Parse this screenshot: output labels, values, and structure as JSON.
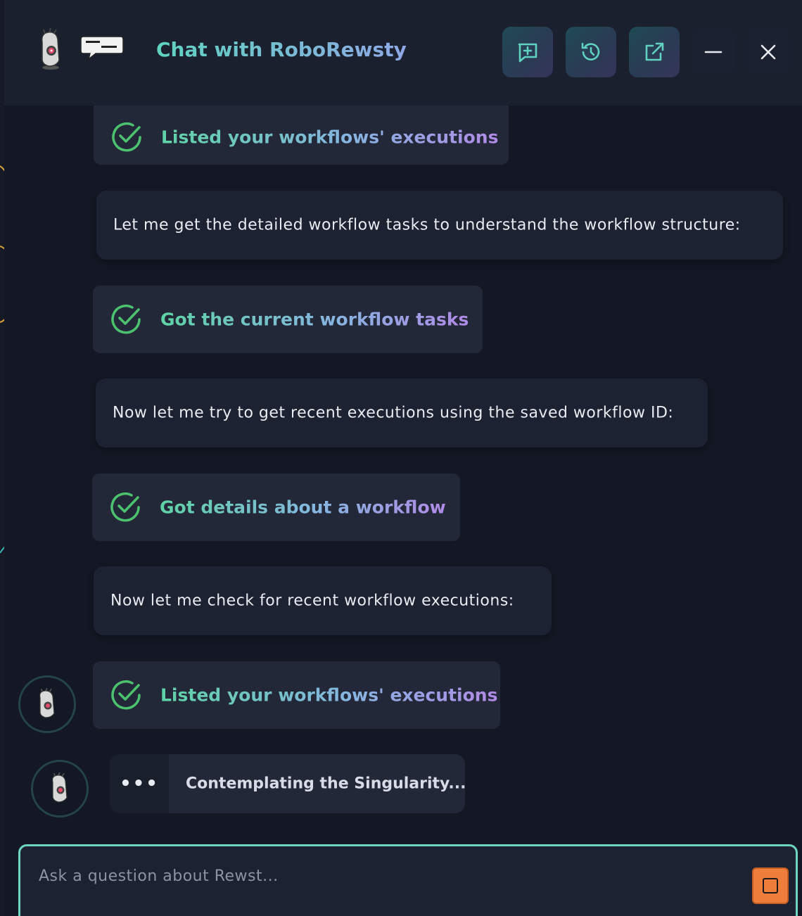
{
  "header": {
    "title": "Chat with RoboRewsty",
    "buttons": {
      "new_chat": "new-chat-icon",
      "history": "history-icon",
      "pop_out": "external-link-icon",
      "minimize": "minimize-icon",
      "close": "close-icon"
    }
  },
  "messages": [
    {
      "type": "tool",
      "label": "Listed your workflows' executions"
    },
    {
      "type": "text",
      "text": "Let me get the detailed workflow tasks to understand the workflow structure:"
    },
    {
      "type": "tool",
      "label": "Got the current workflow tasks"
    },
    {
      "type": "text",
      "text": "Now let me try to get recent executions using the saved workflow ID:"
    },
    {
      "type": "tool",
      "label": "Got details about a workflow"
    },
    {
      "type": "text",
      "text": "Now let me check for recent workflow executions:"
    },
    {
      "type": "tool",
      "label": "Listed your workflows' executions"
    }
  ],
  "typing": {
    "dots": "•••",
    "status": "Contemplating the Singularity..."
  },
  "input": {
    "placeholder": "Ask a question about Rewst...",
    "value": ""
  },
  "colors": {
    "accent": "#6fd4c0",
    "check": "#4cc26e",
    "stop": "#ef7d3c"
  }
}
